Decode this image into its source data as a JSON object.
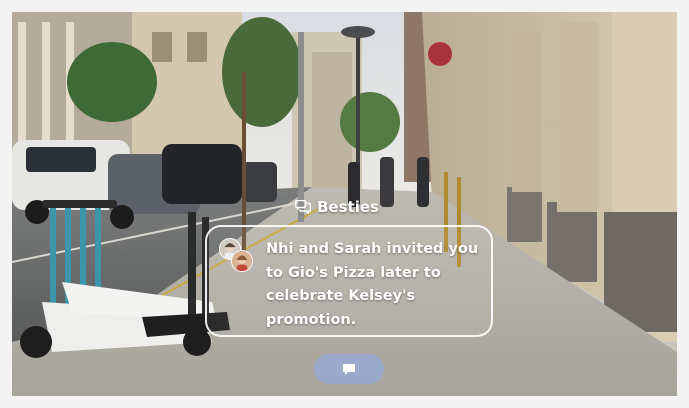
{
  "notification": {
    "group_name": "Besties",
    "group_icon": "chat-bubbles-icon",
    "message": "Nhi and Sarah invited you to Gio's Pizza later to celebrate Kelsey's promotion."
  },
  "reply_button": {
    "icon": "chat-bubble-icon"
  },
  "colors": {
    "text": "#ffffff",
    "card_border": "#ffffff",
    "reply_button": "#96aad7"
  }
}
